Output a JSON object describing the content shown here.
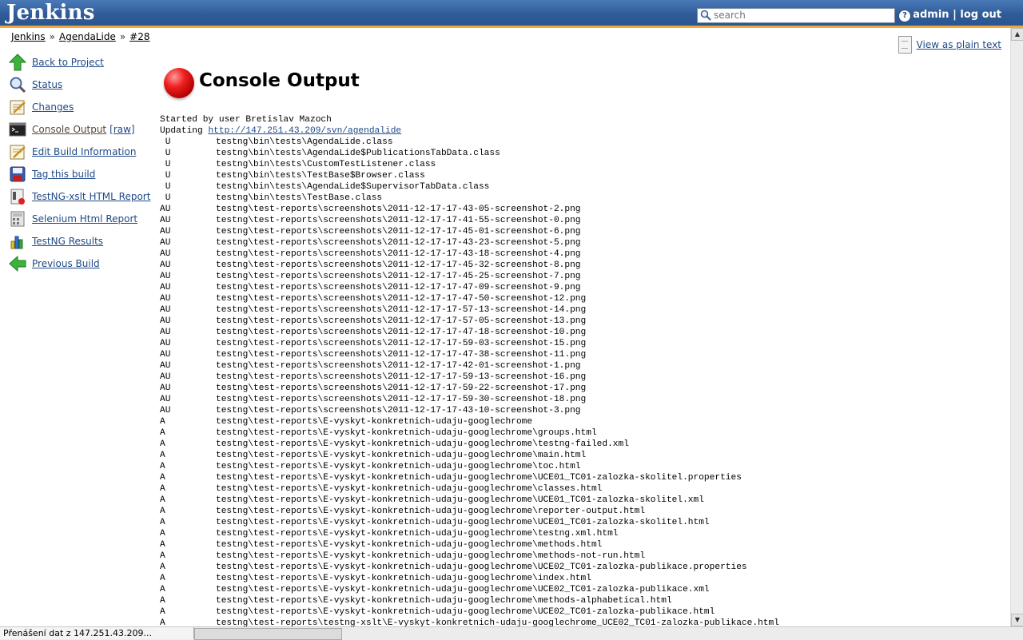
{
  "header": {
    "logo": "Jenkins",
    "search_placeholder": "search",
    "help": "?",
    "user": "admin",
    "separator": "|",
    "logout": "log out"
  },
  "breadcrumbs": [
    "Jenkins",
    "AgendaLide",
    "#28"
  ],
  "breadcrumb_sep": "»",
  "plain_text_link": "View as plain text",
  "tasks": [
    {
      "label": "Back to Project",
      "icon": "up-arrow-icon"
    },
    {
      "label": "Status",
      "icon": "magnifier-icon"
    },
    {
      "label": "Changes",
      "icon": "notepad-icon"
    },
    {
      "label": "Console Output",
      "icon": "terminal-icon",
      "extra": "[raw]"
    },
    {
      "label": "Edit Build Information",
      "icon": "notepad-pencil-icon"
    },
    {
      "label": "Tag this build",
      "icon": "save-icon"
    },
    {
      "label": "TestNG-xslt HTML Report",
      "icon": "report-icon"
    },
    {
      "label": "Selenium Html Report",
      "icon": "calculator-icon"
    },
    {
      "label": "TestNG Results",
      "icon": "bar-chart-icon"
    },
    {
      "label": "Previous Build",
      "icon": "back-arrow-icon"
    }
  ],
  "page_title": "Console Output",
  "status_color": "#e02020",
  "console": {
    "started_by": "Started by user Bretislav Mazoch",
    "updating_prefix": "Updating ",
    "updating_url": "http://147.251.43.209/svn/agendalide",
    "lines": [
      [
        " U",
        "testng\\bin\\tests\\AgendaLide.class"
      ],
      [
        " U",
        "testng\\bin\\tests\\AgendaLide$PublicationsTabData.class"
      ],
      [
        " U",
        "testng\\bin\\tests\\CustomTestListener.class"
      ],
      [
        " U",
        "testng\\bin\\tests\\TestBase$Browser.class"
      ],
      [
        " U",
        "testng\\bin\\tests\\AgendaLide$SupervisorTabData.class"
      ],
      [
        " U",
        "testng\\bin\\tests\\TestBase.class"
      ],
      [
        "AU",
        "testng\\test-reports\\screenshots\\2011-12-17-17-43-05-screenshot-2.png"
      ],
      [
        "AU",
        "testng\\test-reports\\screenshots\\2011-12-17-17-41-55-screenshot-0.png"
      ],
      [
        "AU",
        "testng\\test-reports\\screenshots\\2011-12-17-17-45-01-screenshot-6.png"
      ],
      [
        "AU",
        "testng\\test-reports\\screenshots\\2011-12-17-17-43-23-screenshot-5.png"
      ],
      [
        "AU",
        "testng\\test-reports\\screenshots\\2011-12-17-17-43-18-screenshot-4.png"
      ],
      [
        "AU",
        "testng\\test-reports\\screenshots\\2011-12-17-17-45-32-screenshot-8.png"
      ],
      [
        "AU",
        "testng\\test-reports\\screenshots\\2011-12-17-17-45-25-screenshot-7.png"
      ],
      [
        "AU",
        "testng\\test-reports\\screenshots\\2011-12-17-17-47-09-screenshot-9.png"
      ],
      [
        "AU",
        "testng\\test-reports\\screenshots\\2011-12-17-17-47-50-screenshot-12.png"
      ],
      [
        "AU",
        "testng\\test-reports\\screenshots\\2011-12-17-17-57-13-screenshot-14.png"
      ],
      [
        "AU",
        "testng\\test-reports\\screenshots\\2011-12-17-17-57-05-screenshot-13.png"
      ],
      [
        "AU",
        "testng\\test-reports\\screenshots\\2011-12-17-17-47-18-screenshot-10.png"
      ],
      [
        "AU",
        "testng\\test-reports\\screenshots\\2011-12-17-17-59-03-screenshot-15.png"
      ],
      [
        "AU",
        "testng\\test-reports\\screenshots\\2011-12-17-17-47-38-screenshot-11.png"
      ],
      [
        "AU",
        "testng\\test-reports\\screenshots\\2011-12-17-17-42-01-screenshot-1.png"
      ],
      [
        "AU",
        "testng\\test-reports\\screenshots\\2011-12-17-17-59-13-screenshot-16.png"
      ],
      [
        "AU",
        "testng\\test-reports\\screenshots\\2011-12-17-17-59-22-screenshot-17.png"
      ],
      [
        "AU",
        "testng\\test-reports\\screenshots\\2011-12-17-17-59-30-screenshot-18.png"
      ],
      [
        "AU",
        "testng\\test-reports\\screenshots\\2011-12-17-17-43-10-screenshot-3.png"
      ],
      [
        "A",
        "testng\\test-reports\\E-vyskyt-konkretnich-udaju-googlechrome"
      ],
      [
        "A",
        "testng\\test-reports\\E-vyskyt-konkretnich-udaju-googlechrome\\groups.html"
      ],
      [
        "A",
        "testng\\test-reports\\E-vyskyt-konkretnich-udaju-googlechrome\\testng-failed.xml"
      ],
      [
        "A",
        "testng\\test-reports\\E-vyskyt-konkretnich-udaju-googlechrome\\main.html"
      ],
      [
        "A",
        "testng\\test-reports\\E-vyskyt-konkretnich-udaju-googlechrome\\toc.html"
      ],
      [
        "A",
        "testng\\test-reports\\E-vyskyt-konkretnich-udaju-googlechrome\\UCE01_TC01-zalozka-skolitel.properties"
      ],
      [
        "A",
        "testng\\test-reports\\E-vyskyt-konkretnich-udaju-googlechrome\\classes.html"
      ],
      [
        "A",
        "testng\\test-reports\\E-vyskyt-konkretnich-udaju-googlechrome\\UCE01_TC01-zalozka-skolitel.xml"
      ],
      [
        "A",
        "testng\\test-reports\\E-vyskyt-konkretnich-udaju-googlechrome\\reporter-output.html"
      ],
      [
        "A",
        "testng\\test-reports\\E-vyskyt-konkretnich-udaju-googlechrome\\UCE01_TC01-zalozka-skolitel.html"
      ],
      [
        "A",
        "testng\\test-reports\\E-vyskyt-konkretnich-udaju-googlechrome\\testng.xml.html"
      ],
      [
        "A",
        "testng\\test-reports\\E-vyskyt-konkretnich-udaju-googlechrome\\methods.html"
      ],
      [
        "A",
        "testng\\test-reports\\E-vyskyt-konkretnich-udaju-googlechrome\\methods-not-run.html"
      ],
      [
        "A",
        "testng\\test-reports\\E-vyskyt-konkretnich-udaju-googlechrome\\UCE02_TC01-zalozka-publikace.properties"
      ],
      [
        "A",
        "testng\\test-reports\\E-vyskyt-konkretnich-udaju-googlechrome\\index.html"
      ],
      [
        "A",
        "testng\\test-reports\\E-vyskyt-konkretnich-udaju-googlechrome\\UCE02_TC01-zalozka-publikace.xml"
      ],
      [
        "A",
        "testng\\test-reports\\E-vyskyt-konkretnich-udaju-googlechrome\\methods-alphabetical.html"
      ],
      [
        "A",
        "testng\\test-reports\\E-vyskyt-konkretnich-udaju-googlechrome\\UCE02_TC01-zalozka-publikace.html"
      ],
      [
        "A",
        "testng\\test-reports\\testng-xslt\\E-vyskyt-konkretnich-udaju-googlechrome_UCE02_TC01-zalozka-publikace.html"
      ]
    ]
  },
  "statusbar": {
    "text": "Přenášení dat z 147.251.43.209..."
  }
}
